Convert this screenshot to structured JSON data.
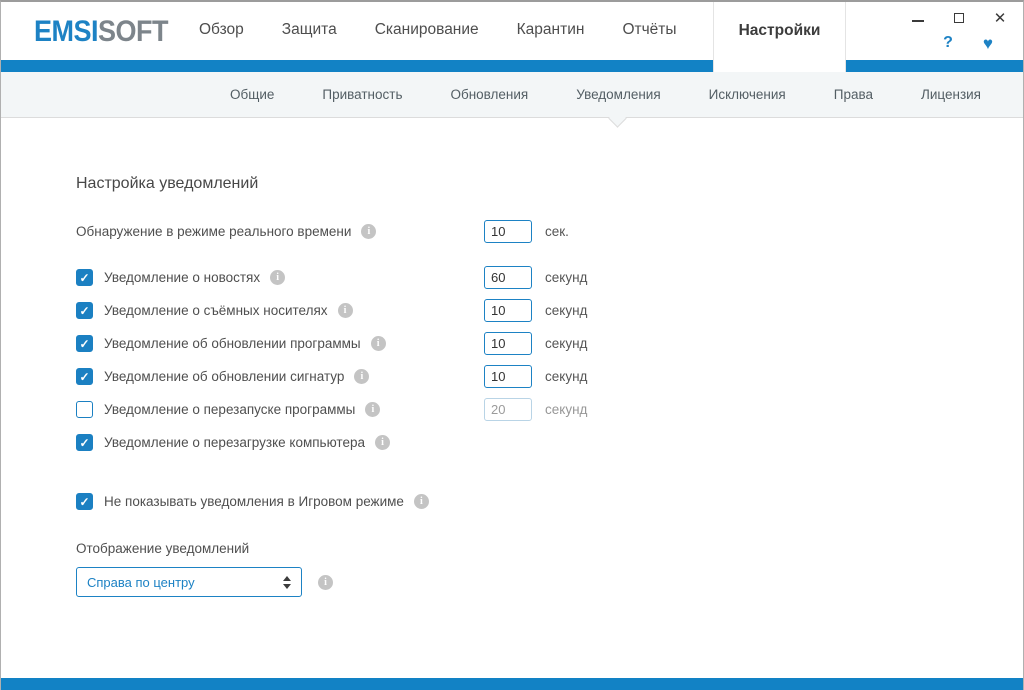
{
  "colors": {
    "accent": "#1282c5",
    "accent_link": "#1d82c4",
    "checkbox": "#1b80c2",
    "logo_gray": "#7d858b"
  },
  "icons": {
    "help": "?",
    "heart": "♥",
    "close": "✕",
    "info": "i",
    "checkmark": "✓"
  },
  "header": {
    "logo": {
      "blue": "EMSI",
      "gray": "SOFT"
    },
    "nav": [
      {
        "label": "Обзор",
        "active": false
      },
      {
        "label": "Защита",
        "active": false
      },
      {
        "label": "Сканирование",
        "active": false
      },
      {
        "label": "Карантин",
        "active": false
      },
      {
        "label": "Отчёты",
        "active": false
      },
      {
        "label": "Настройки",
        "active": true
      }
    ]
  },
  "subnav": {
    "tabs": [
      {
        "label": "Общие",
        "active": false
      },
      {
        "label": "Приватность",
        "active": false
      },
      {
        "label": "Обновления",
        "active": false
      },
      {
        "label": "Уведомления",
        "active": true
      },
      {
        "label": "Исключения",
        "active": false
      },
      {
        "label": "Права",
        "active": false
      },
      {
        "label": "Лицензия",
        "active": false
      }
    ]
  },
  "content": {
    "heading": "Настройка уведомлений",
    "realtime": {
      "label": "Обнаружение в режиме реального времени",
      "value": "10",
      "unit": "сек."
    },
    "rows": [
      {
        "label": "Уведомление о новостях",
        "checked": true,
        "value": "60",
        "unit": "секунд",
        "disabled": false
      },
      {
        "label": "Уведомление о съёмных носителях",
        "checked": true,
        "value": "10",
        "unit": "секунд",
        "disabled": false
      },
      {
        "label": "Уведомление об обновлении программы",
        "checked": true,
        "value": "10",
        "unit": "секунд",
        "disabled": false
      },
      {
        "label": "Уведомление об обновлении сигнатур",
        "checked": true,
        "value": "10",
        "unit": "секунд",
        "disabled": false
      },
      {
        "label": "Уведомление о перезапуске программы",
        "checked": false,
        "value": "20",
        "unit": "секунд",
        "disabled": true
      },
      {
        "label": "Уведомление о перезагрузке компьютера",
        "checked": true,
        "disabled": false
      }
    ],
    "game_mode": {
      "label": "Не показывать уведомления в Игровом режиме",
      "checked": true
    },
    "display": {
      "label": "Отображение уведомлений",
      "selected": "Справа по центру"
    }
  }
}
